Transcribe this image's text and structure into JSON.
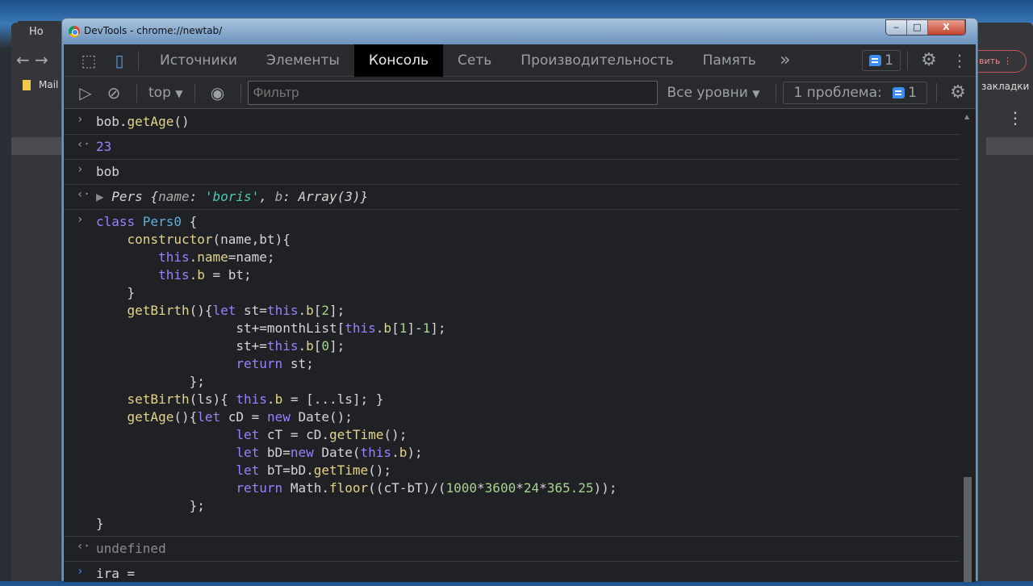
{
  "background_browser": {
    "tab_label": "Но",
    "bookmark": "Mail",
    "save_button": "вить",
    "bookmarks_label": "закладки"
  },
  "window": {
    "title": "DevTools - chrome://newtab/",
    "minimize": "‒",
    "maximize": "□",
    "close": "X"
  },
  "toolbar": {
    "tabs": [
      "Источники",
      "Элементы",
      "Консоль",
      "Сеть",
      "Производительность",
      "Память"
    ],
    "active_tab": "Консоль",
    "more": "»",
    "issues_count": "1",
    "context": "top",
    "filter_placeholder": "Фильтр",
    "levels": "Все уровни",
    "problems_label": "1 проблема:",
    "problems_count": "1"
  },
  "console": {
    "entries": [
      {
        "input": [
          [
            [
              "bob.",
              "pl"
            ],
            [
              "getAge",
              "fn"
            ],
            [
              "()",
              "pl"
            ]
          ]
        ],
        "output": [
          [
            "23",
            "kw"
          ]
        ]
      },
      {
        "input": [
          [
            [
              "bob",
              "pl"
            ]
          ]
        ],
        "output": [
          [
            "▶ ",
            "dim"
          ],
          [
            "Pers ",
            "pl"
          ],
          [
            "{",
            "pl"
          ],
          [
            "name",
            "prop"
          ],
          [
            ": ",
            "pl"
          ],
          [
            "'boris'",
            "str"
          ],
          [
            ", ",
            "pl"
          ],
          [
            "b",
            "prop"
          ],
          [
            ": ",
            "pl"
          ],
          [
            "Array(3)",
            "pl"
          ],
          [
            "}",
            "pl"
          ]
        ],
        "italic": true
      },
      {
        "input": [
          [
            [
              "class ",
              "kw"
            ],
            [
              "Pers0 ",
              "cls"
            ],
            [
              "{",
              "pl"
            ]
          ],
          [
            [
              "    ",
              "pl"
            ],
            [
              "constructor",
              "fn"
            ],
            [
              "(name,bt){",
              "pl"
            ]
          ],
          [
            [
              "        ",
              "pl"
            ],
            [
              "this",
              "kw"
            ],
            [
              ".",
              "pl"
            ],
            [
              "name",
              "fn"
            ],
            [
              "=name;",
              "pl"
            ]
          ],
          [
            [
              "        ",
              "pl"
            ],
            [
              "this",
              "kw"
            ],
            [
              ".",
              "pl"
            ],
            [
              "b",
              "fn"
            ],
            [
              " = bt;",
              "pl"
            ]
          ],
          [
            [
              "    }",
              "pl"
            ]
          ],
          [
            [
              "    ",
              "pl"
            ],
            [
              "getBirth",
              "fn"
            ],
            [
              "(){",
              "pl"
            ],
            [
              "let ",
              "kw"
            ],
            [
              "st=",
              "pl"
            ],
            [
              "this",
              "kw"
            ],
            [
              ".",
              "pl"
            ],
            [
              "b",
              "fn"
            ],
            [
              "[",
              "pl"
            ],
            [
              "2",
              "num"
            ],
            [
              "];",
              "pl"
            ]
          ],
          [
            [
              "                  st+=monthList[",
              "pl"
            ],
            [
              "this",
              "kw"
            ],
            [
              ".",
              "pl"
            ],
            [
              "b",
              "fn"
            ],
            [
              "[",
              "pl"
            ],
            [
              "1",
              "num"
            ],
            [
              "]-",
              "pl"
            ],
            [
              "1",
              "num"
            ],
            [
              "];",
              "pl"
            ]
          ],
          [
            [
              "                  st+=",
              "pl"
            ],
            [
              "this",
              "kw"
            ],
            [
              ".",
              "pl"
            ],
            [
              "b",
              "fn"
            ],
            [
              "[",
              "pl"
            ],
            [
              "0",
              "num"
            ],
            [
              "];",
              "pl"
            ]
          ],
          [
            [
              "                  ",
              "pl"
            ],
            [
              "return ",
              "kw"
            ],
            [
              "st;",
              "pl"
            ]
          ],
          [
            [
              "            };",
              "pl"
            ]
          ],
          [
            [
              "    ",
              "pl"
            ],
            [
              "setBirth",
              "fn"
            ],
            [
              "(ls){ ",
              "pl"
            ],
            [
              "this",
              "kw"
            ],
            [
              ".",
              "pl"
            ],
            [
              "b",
              "fn"
            ],
            [
              " = [...ls]; }",
              "pl"
            ]
          ],
          [
            [
              "    ",
              "pl"
            ],
            [
              "getAge",
              "fn"
            ],
            [
              "(){",
              "pl"
            ],
            [
              "let ",
              "kw"
            ],
            [
              "cD = ",
              "pl"
            ],
            [
              "new ",
              "kw"
            ],
            [
              "Date();",
              "pl"
            ]
          ],
          [
            [
              "                  ",
              "pl"
            ],
            [
              "let ",
              "kw"
            ],
            [
              "cT = cD.",
              "pl"
            ],
            [
              "getTime",
              "fn"
            ],
            [
              "();",
              "pl"
            ]
          ],
          [
            [
              "                  ",
              "pl"
            ],
            [
              "let ",
              "kw"
            ],
            [
              "bD=",
              "pl"
            ],
            [
              "new ",
              "kw"
            ],
            [
              "Date(",
              "pl"
            ],
            [
              "this",
              "kw"
            ],
            [
              ".",
              "pl"
            ],
            [
              "b",
              "fn"
            ],
            [
              ");",
              "pl"
            ]
          ],
          [
            [
              "                  ",
              "pl"
            ],
            [
              "let ",
              "kw"
            ],
            [
              "bT=bD.",
              "pl"
            ],
            [
              "getTime",
              "fn"
            ],
            [
              "();",
              "pl"
            ]
          ],
          [
            [
              "                  ",
              "pl"
            ],
            [
              "return ",
              "kw"
            ],
            [
              "Math.",
              "pl"
            ],
            [
              "floor",
              "fn"
            ],
            [
              "((cT-bT)/(",
              "pl"
            ],
            [
              "1000",
              "num"
            ],
            [
              "*",
              "pl"
            ],
            [
              "3600",
              "num"
            ],
            [
              "*",
              "pl"
            ],
            [
              "24",
              "num"
            ],
            [
              "*",
              "pl"
            ],
            [
              "365.25",
              "num"
            ],
            [
              "));",
              "pl"
            ]
          ],
          [
            [
              "            };",
              "pl"
            ]
          ],
          [
            [
              "}",
              "pl"
            ]
          ]
        ],
        "output": [
          [
            "undefined",
            "dim"
          ]
        ]
      }
    ],
    "current_input": "ira ="
  },
  "icons": {
    "prompt": "›",
    "result": "‹·"
  }
}
